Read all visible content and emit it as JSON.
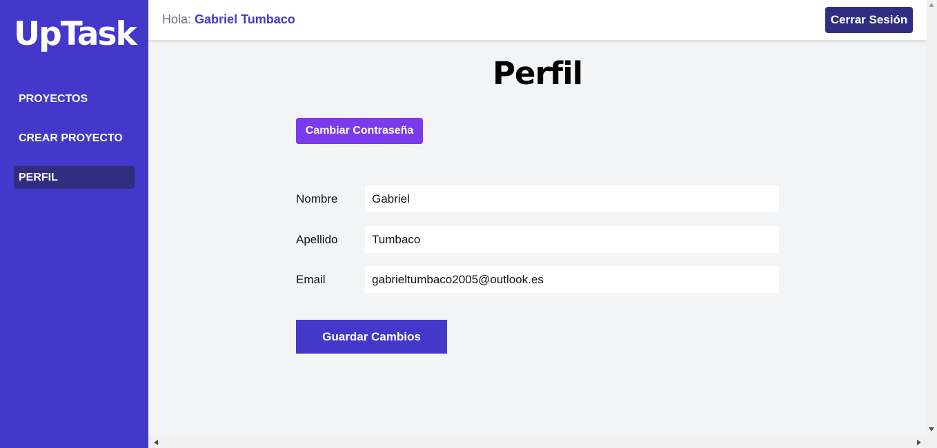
{
  "sidebar": {
    "logo": "UpTask",
    "items": [
      {
        "label": "PROYECTOS"
      },
      {
        "label": "CREAR PROYECTO"
      },
      {
        "label": "PERFIL"
      }
    ]
  },
  "header": {
    "greeting_prefix": "Hola:",
    "user_name": "Gabriel Tumbaco",
    "logout_label": "Cerrar Sesión"
  },
  "main": {
    "title": "Perfil",
    "change_password_label": "Cambiar Contraseña",
    "fields": {
      "nombre": {
        "label": "Nombre",
        "value": "Gabriel"
      },
      "apellido": {
        "label": "Apellido",
        "value": "Tumbaco"
      },
      "email": {
        "label": "Email",
        "value": "gabrieltumbaco2005@outlook.es"
      }
    },
    "save_label": "Guardar Cambios"
  },
  "colors": {
    "sidebar_bg": "#4338ca",
    "active_item_bg": "#312e81",
    "accent_purple": "#7c3aed",
    "page_bg": "#f3f4f6"
  }
}
